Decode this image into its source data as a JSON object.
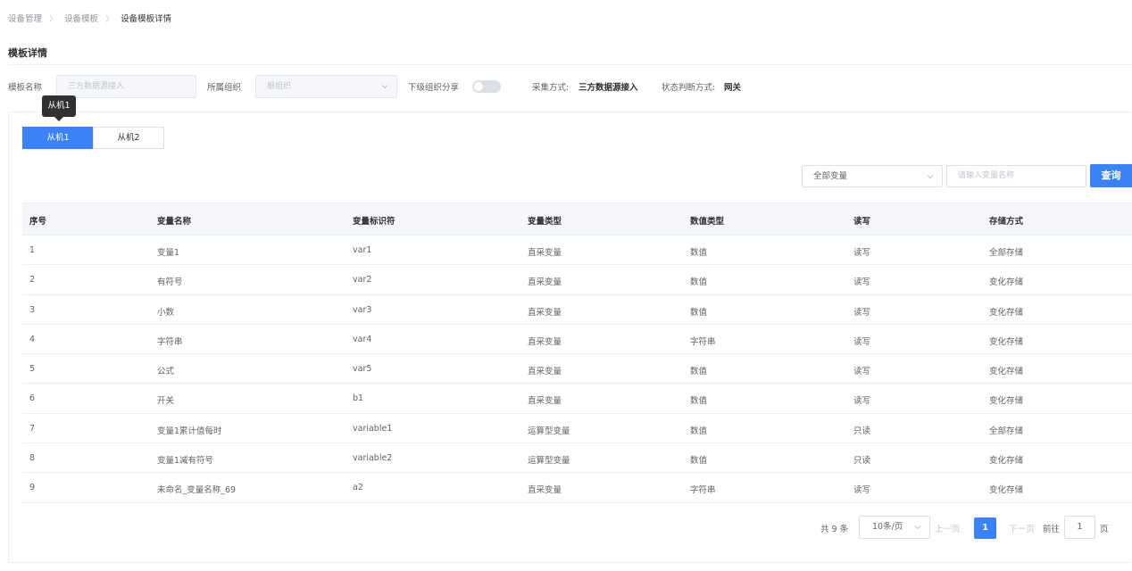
{
  "breadcrumb": [
    "设备管理",
    "设备模板",
    "设备模板详情"
  ],
  "breadcrumb_sep": "〉",
  "section_title": "模板详情",
  "form": {
    "template_name_label": "模板名称",
    "template_name_value": "三方数据源接入",
    "org_label": "所属组织",
    "org_value": "根组织",
    "share_label": "下级组织分享",
    "share_enabled": false,
    "collect_label": "采集方式:",
    "collect_value": "三方数据源接入",
    "status_label": "状态判断方式:",
    "status_value": "网关"
  },
  "tooltip": "从机1",
  "tabs": [
    {
      "label": "从机1",
      "active": true
    },
    {
      "label": "从机2",
      "active": false
    }
  ],
  "filter": {
    "select_value": "全部变量",
    "input_placeholder": "请输入变量名称",
    "query_label": "查询"
  },
  "table": {
    "columns": [
      "序号",
      "变量名称",
      "变量标识符",
      "变量类型",
      "数值类型",
      "读写",
      "存储方式"
    ],
    "rows": [
      [
        "1",
        "变量1",
        "var1",
        "直采变量",
        "数值",
        "读写",
        "全部存储"
      ],
      [
        "2",
        "有符号",
        "var2",
        "直采变量",
        "数值",
        "读写",
        "变化存储"
      ],
      [
        "3",
        "小数",
        "var3",
        "直采变量",
        "数值",
        "读写",
        "变化存储"
      ],
      [
        "4",
        "字符串",
        "var4",
        "直采变量",
        "字符串",
        "读写",
        "变化存储"
      ],
      [
        "5",
        "公式",
        "var5",
        "直采变量",
        "数值",
        "读写",
        "变化存储"
      ],
      [
        "6",
        "开关",
        "b1",
        "直采变量",
        "数值",
        "读写",
        "变化存储"
      ],
      [
        "7",
        "变量1累计值每时",
        "variable1",
        "运算型变量",
        "数值",
        "只读",
        "全部存储"
      ],
      [
        "8",
        "变量1减有符号",
        "variable2",
        "运算型变量",
        "数值",
        "只读",
        "变化存储"
      ],
      [
        "9",
        "未命名_变量名称_69",
        "a2",
        "直采变量",
        "字符串",
        "读写",
        "变化存储"
      ]
    ]
  },
  "pagination": {
    "total": "共 9 条",
    "page_size": "10条/页",
    "prev": "上一页",
    "current": "1",
    "next": "下一页",
    "goto": "前往",
    "jump_value": "1",
    "page_suffix": "页"
  },
  "colors": {
    "primary": "#3b82f6",
    "tooltip_bg": "#303133"
  }
}
